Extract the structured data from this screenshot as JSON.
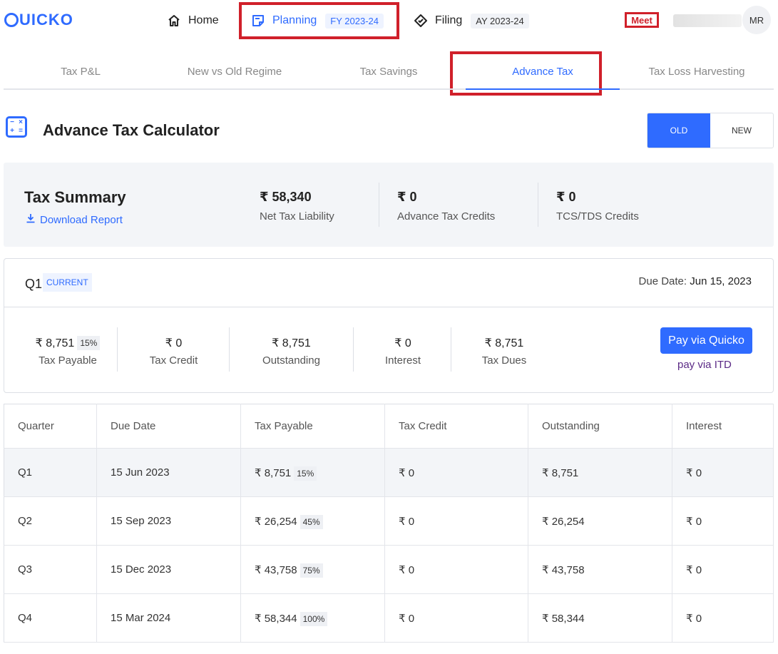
{
  "nav": {
    "logo": "UICKO",
    "home": "Home",
    "planning": "Planning",
    "planning_badge": "FY 2023-24",
    "filing": "Filing",
    "filing_badge": "AY 2023-24",
    "meet": "Meet",
    "avatar": "MR"
  },
  "tabs": [
    "Tax P&L",
    "New vs Old Regime",
    "Tax Savings",
    "Advance Tax",
    "Tax Loss Harvesting"
  ],
  "header": {
    "title": "Advance Tax Calculator",
    "regime_old": "OLD",
    "regime_new": "NEW"
  },
  "summary": {
    "title": "Tax Summary",
    "download": "Download Report",
    "net_liability_value": "₹ 58,340",
    "net_liability_label": "Net Tax Liability",
    "adv_credits_value": "₹ 0",
    "adv_credits_label": "Advance Tax Credits",
    "tcs_value": "₹ 0",
    "tcs_label": "TCS/TDS Credits"
  },
  "quarter": {
    "name": "Q1",
    "status": "CURRENT",
    "due_label": "Due Date:",
    "due_value": "Jun 15, 2023",
    "tax_payable": "₹ 8,751",
    "tax_payable_pct": "15%",
    "tax_payable_label": "Tax Payable",
    "tax_credit": "₹ 0",
    "tax_credit_label": "Tax Credit",
    "outstanding": "₹ 8,751",
    "outstanding_label": "Outstanding",
    "interest": "₹ 0",
    "interest_label": "Interest",
    "tax_dues": "₹ 8,751",
    "tax_dues_label": "Tax Dues",
    "pay_button": "Pay via Quicko",
    "pay_itd": "pay via ITD"
  },
  "table": {
    "headers": [
      "Quarter",
      "Due Date",
      "Tax Payable",
      "Tax Credit",
      "Outstanding",
      "Interest"
    ],
    "rows": [
      {
        "quarter": "Q1",
        "due": "15 Jun 2023",
        "payable": "₹ 8,751",
        "pct": "15%",
        "credit": "₹ 0",
        "outstanding": "₹ 8,751",
        "interest": "₹ 0"
      },
      {
        "quarter": "Q2",
        "due": "15 Sep 2023",
        "payable": "₹ 26,254",
        "pct": "45%",
        "credit": "₹ 0",
        "outstanding": "₹ 26,254",
        "interest": "₹ 0"
      },
      {
        "quarter": "Q3",
        "due": "15 Dec 2023",
        "payable": "₹ 43,758",
        "pct": "75%",
        "credit": "₹ 0",
        "outstanding": "₹ 43,758",
        "interest": "₹ 0"
      },
      {
        "quarter": "Q4",
        "due": "15 Mar 2024",
        "payable": "₹ 58,344",
        "pct": "100%",
        "credit": "₹ 0",
        "outstanding": "₹ 58,344",
        "interest": "₹ 0"
      }
    ]
  },
  "colors": {
    "accent": "#2f6bff",
    "highlight": "#d0202a"
  }
}
